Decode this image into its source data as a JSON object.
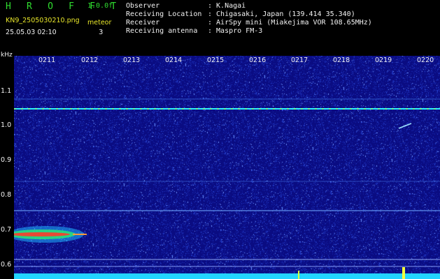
{
  "header": {
    "brand": "H R O F F T",
    "version": "1.0.0f",
    "filename": "KN9_2505030210.png",
    "timestamp": "25.05.03 02:10",
    "meteor_label": "meteor",
    "meteor_count": "3",
    "info": [
      {
        "key": "Observer",
        "value": ": K.Nagai"
      },
      {
        "key": "Receiving Location",
        "value": ": Chigasaki, Japan (139.414 35.340)"
      },
      {
        "key": "Receiver",
        "value": ": AirSpy mini (Miakejima VOR 108.65MHz)"
      },
      {
        "key": "Receiving antenna",
        "value": ": Maspro FM-3"
      }
    ]
  },
  "axes": {
    "y_unit": "kHz",
    "y_ticks": [
      "1.1",
      "1.0",
      "0.9",
      "0.8",
      "0.7",
      "0.6"
    ],
    "x_ticks": [
      "0211",
      "0212",
      "0213",
      "0214",
      "0215",
      "0216",
      "0217",
      "0218",
      "0219",
      "0220"
    ]
  },
  "colors": {
    "background": "#0a0c82",
    "text_green": "#2fdc2f",
    "text_yellow": "#e9e72a",
    "carrier": "#2af0ff",
    "baseline": "#1ee6ff"
  }
}
